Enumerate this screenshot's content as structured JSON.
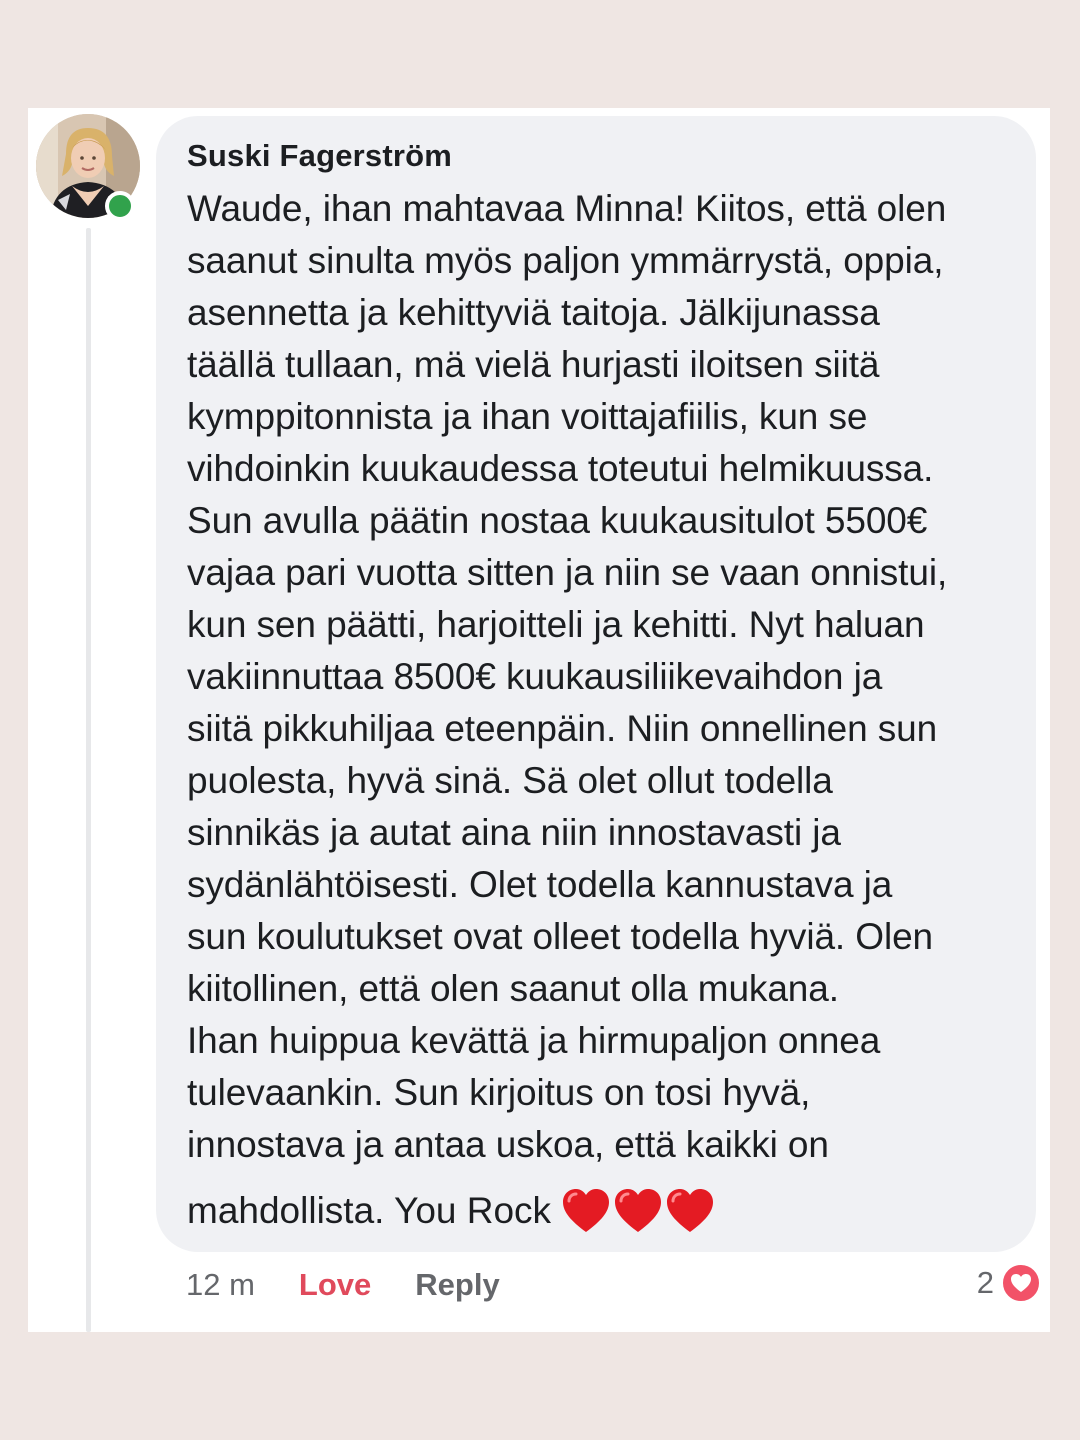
{
  "comment": {
    "author": "Suski Fagerström",
    "text": "Waude, ihan mahtavaa Minna! Kiitos, että olen\nsaanut sinulta myös paljon ymmärrystä, oppia,\nasennetta ja kehittyviä taitoja. Jälkijunassa\ntäällä tullaan, mä vielä hurjasti iloitsen siitä\nkymppitonnista ja ihan voittajafiilis, kun se\nvihdoinkin kuukaudessa toteutui helmikuussa.\nSun avulla päätin nostaa kuukausitulot 5500€\nvajaa pari vuotta sitten ja niin se vaan onnistui,\nkun sen päätti, harjoitteli ja kehitti. Nyt haluan\nvakiinnuttaa 8500€ kuukausiliikevaihdon ja\nsiitä pikkuhiljaa eteenpäin. Niin onnellinen sun\npuolesta, hyvä sinä. Sä olet ollut todella\nsinnikäs ja autat aina niin innostavasti ja\nsydänlähtöisesti. Olet todella kannustava ja\nsun koulutukset ovat olleet todella hyviä. Olen\nkiitollinen, että olen saanut olla mukana.\nIhan huippua kevättä ja hirmupaljon onnea\ntulevaankin. Sun kirjoitus on tosi hyvä,\ninnostava ja antaa uskoa, että kaikki on",
    "last_line": "mahdollista. You Rock",
    "emoji": [
      "heart-emoji",
      "heart-emoji",
      "heart-emoji"
    ],
    "online_status_color": "#31a24c"
  },
  "actions": {
    "time": "12 m",
    "love_label": "Love",
    "reply_label": "Reply",
    "reaction_count": "2",
    "reaction_icon": "love-reaction-icon"
  },
  "colors": {
    "background": "#efe6e3",
    "bubble": "#f0f1f4",
    "love": "#e04a5c",
    "muted": "#65676b"
  }
}
